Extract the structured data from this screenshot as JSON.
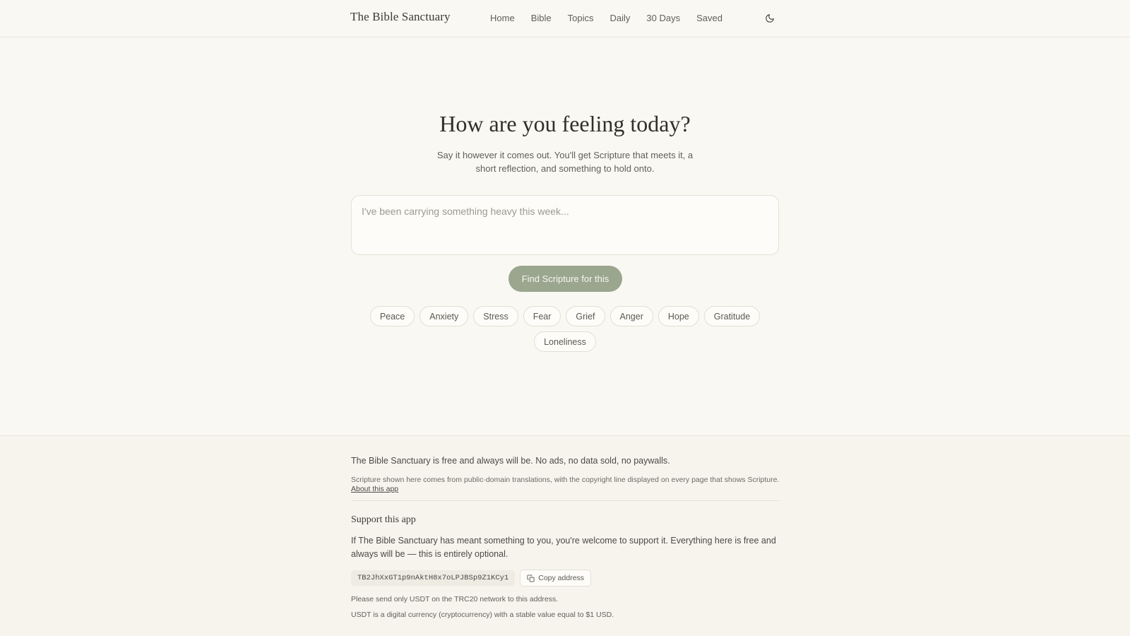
{
  "header": {
    "brand": "The Bible Sanctuary",
    "nav": [
      "Home",
      "Bible",
      "Topics",
      "Daily",
      "30 Days",
      "Saved"
    ],
    "theme_icon": "moon-icon"
  },
  "hero": {
    "title": "How are you feeling today?",
    "subtitle": "Say it however it comes out. You'll get Scripture that meets it, a short reflection, and something to hold onto.",
    "input_placeholder": "I've been carrying something heavy this week...",
    "input_value": "",
    "find_button": "Find Scripture for this",
    "chips": [
      "Peace",
      "Anxiety",
      "Stress",
      "Fear",
      "Grief",
      "Anger",
      "Hope",
      "Gratitude",
      "Loneliness"
    ]
  },
  "footer": {
    "free_line": "The Bible Sanctuary is free and always will be. No ads, no data sold, no paywalls.",
    "source_line": "Scripture shown here comes from public-domain translations, with the copyright line displayed on every page that shows Scripture.",
    "about_link": "About this app",
    "support_title": "Support this app",
    "support_text": "If The Bible Sanctuary has meant something to you, you're welcome to support it. Everything here is free and always will be — this is entirely optional.",
    "address": "TB2JhXxGT1p9nAktH8x7oLPJBSp9Z1KCy1",
    "copy_button": "Copy address",
    "copy_icon": "copy-icon",
    "note_network": "Please send only USDT on the TRC20 network to this address.",
    "note_usdt": "USDT is a digital currency (cryptocurrency) with a stable value equal to $1 USD."
  }
}
